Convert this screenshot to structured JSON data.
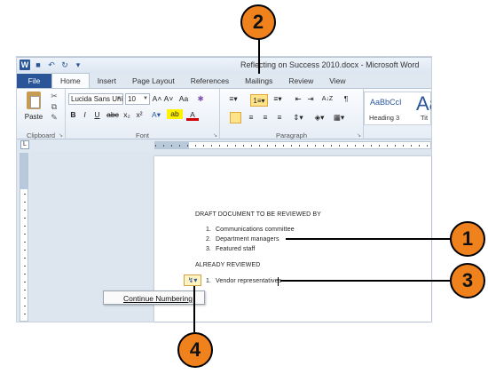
{
  "window": {
    "title": "Reflecting on Success 2010.docx - Microsoft Word",
    "app_icon": "W"
  },
  "tabs": [
    "File",
    "Home",
    "Insert",
    "Page Layout",
    "References",
    "Mailings",
    "Review",
    "View"
  ],
  "ribbon": {
    "clipboard": {
      "paste_label": "Paste",
      "group_label": "Clipboard"
    },
    "font": {
      "font_name": "Lucida Sans Uni",
      "font_size": "10",
      "grow_font": "A˄",
      "shrink_font": "A˅",
      "change_case": "Aa",
      "bold": "B",
      "italic": "I",
      "underline": "U",
      "strikethrough": "abc",
      "subscript": "x₂",
      "superscript": "x²",
      "font_color": "A",
      "group_label": "Font"
    },
    "paragraph": {
      "group_label": "Paragraph",
      "show_marks": "¶",
      "sort": "A↓Z"
    },
    "styles": {
      "sample": "AaBbCcI",
      "name": "Heading 3",
      "sample2": "Aa",
      "name2": "Tit"
    }
  },
  "document": {
    "heading1": "DRAFT DOCUMENT TO BE REVIEWED BY",
    "list1": [
      {
        "num": "1.",
        "text": "Communications committee"
      },
      {
        "num": "2.",
        "text": "Department managers"
      },
      {
        "num": "3.",
        "text": "Featured staff"
      }
    ],
    "heading2": "ALREADY REVIEWED",
    "list2": [
      {
        "num": "1.",
        "text": "Vendor representatives"
      }
    ]
  },
  "autocorrect_menu": {
    "item": "Continue Numbering"
  },
  "callouts": [
    "1",
    "2",
    "3",
    "4"
  ],
  "colors": {
    "callout_fill": "#f0821d",
    "file_tab": "#2a5699",
    "highlight": "#ffe38a"
  }
}
